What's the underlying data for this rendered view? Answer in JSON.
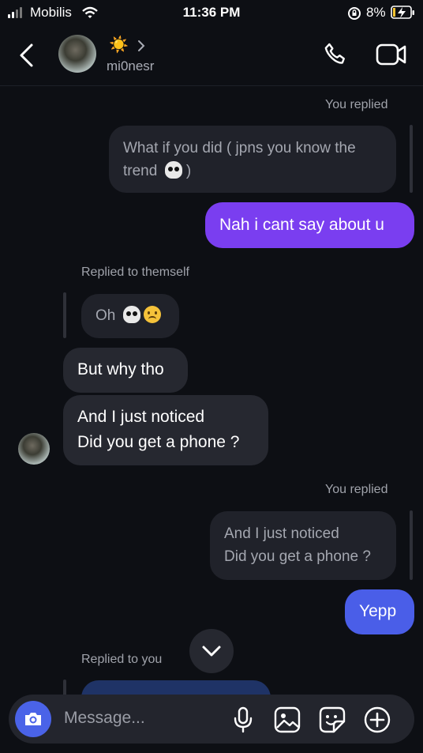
{
  "status_bar": {
    "carrier": "Mobilis",
    "time": "11:36 PM",
    "battery": "8%"
  },
  "header": {
    "username": "mi0nesr",
    "status_emoji": "☀️"
  },
  "messages": {
    "you_replied_1": "You replied",
    "quote_1": "What if you did ( jpns you know the trend",
    "sent_1": "Nah i cant say about u",
    "replied_to_themself": "Replied to themself",
    "quote_2": "Oh",
    "recv_1": "But why tho",
    "recv_2_line1": "And I just noticed",
    "recv_2_line2": "Did you get a phone ?",
    "you_replied_2": "You replied",
    "quote_3_line1": "And I just noticed",
    "quote_3_line2": "Did you get a phone ?",
    "sent_2": "Yepp",
    "replied_to_you": "Replied to you"
  },
  "composer": {
    "placeholder": "Message..."
  },
  "colors": {
    "background": "#0d0f14",
    "purple_bubble": "#7a3ef0",
    "blue_bubble": "#4a5ee8",
    "received_bubble": "#262830"
  },
  "icons": [
    "back-arrow-icon",
    "chevron-right-icon",
    "phone-icon",
    "video-camera-icon",
    "camera-icon",
    "microphone-icon",
    "gallery-icon",
    "sticker-icon",
    "plus-icon",
    "chevron-down-icon"
  ]
}
